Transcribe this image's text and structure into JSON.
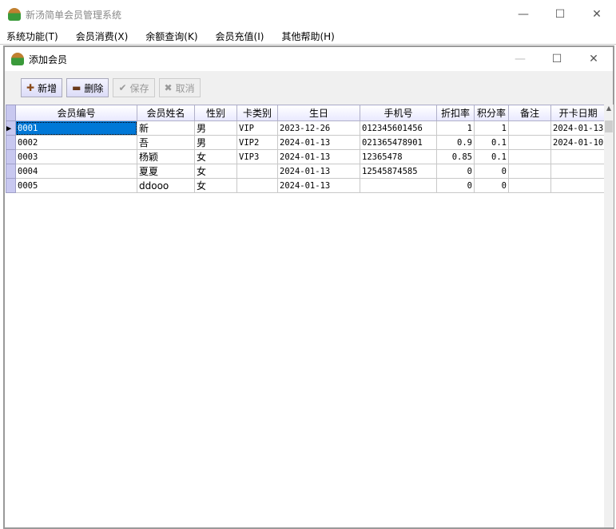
{
  "app": {
    "title": "新汤简单会员管理系统",
    "minimize": "—",
    "maximize": "☐",
    "close": "✕"
  },
  "menu": [
    "系统功能(T)",
    "会员消费(X)",
    "余额查询(K)",
    "会员充值(I)",
    "其他帮助(H)"
  ],
  "child": {
    "title": "添加会员",
    "minimize": "—",
    "maximize": "☐",
    "close": "✕"
  },
  "toolbar": {
    "add": "新增",
    "delete": "删除",
    "save": "保存",
    "cancel": "取消"
  },
  "grid": {
    "columns": [
      "会员编号",
      "会员姓名",
      "性别",
      "卡类别",
      "生日",
      "手机号",
      "折扣率",
      "积分率",
      "备注",
      "开卡日期"
    ],
    "rows": [
      [
        "0001",
        "新",
        "男",
        "VIP",
        "2023-12-26",
        "012345601456",
        "1",
        "1",
        "",
        "2024-01-13"
      ],
      [
        "0002",
        "吾",
        "男",
        "VIP2",
        "2024-01-13",
        "021365478901",
        "0.9",
        "0.1",
        "",
        "2024-01-10"
      ],
      [
        "0003",
        "杨颖",
        "女",
        "VIP3",
        "2024-01-13",
        "12365478",
        "0.85",
        "0.1",
        "",
        ""
      ],
      [
        "0004",
        "夏夏",
        "女",
        "",
        "2024-01-13",
        "12545874585",
        "0",
        "0",
        "",
        ""
      ],
      [
        "0005",
        "ddooo",
        "女",
        "",
        "2024-01-13",
        "",
        "0",
        "0",
        "",
        ""
      ]
    ]
  }
}
